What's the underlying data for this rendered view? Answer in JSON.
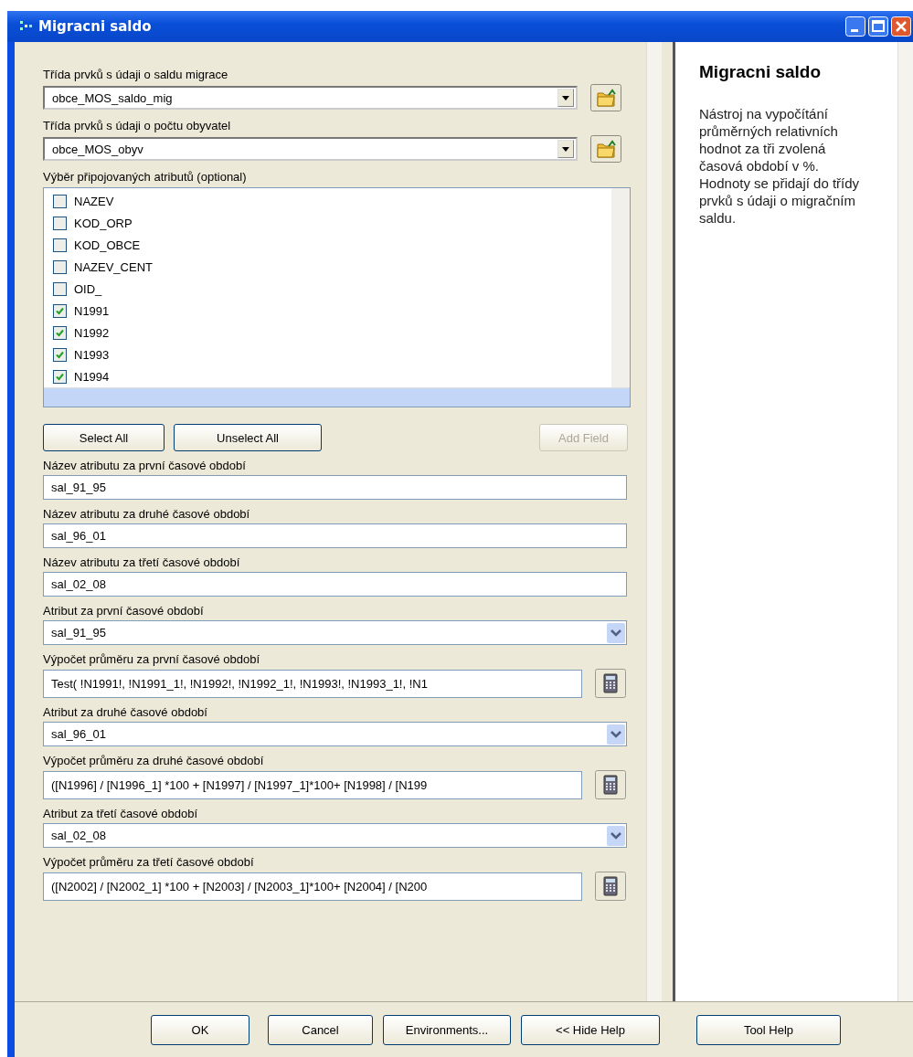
{
  "window": {
    "title": "Migracni saldo"
  },
  "form": [
    {
      "kind": "dropdown",
      "label": "Třída prvků s údaji o saldu migrace",
      "value": "obce_MOS_saldo_mig"
    },
    {
      "kind": "dropdown",
      "label": "Třída prvků s údaji o počtu obyvatel",
      "value": "obce_MOS_obyv"
    },
    {
      "kind": "checklist",
      "label": "Výběr připojovaných atributů (optional)",
      "items": [
        {
          "label": "NAZEV",
          "checked": false
        },
        {
          "label": "KOD_ORP",
          "checked": false
        },
        {
          "label": "KOD_OBCE",
          "checked": false
        },
        {
          "label": "NAZEV_CENT",
          "checked": false
        },
        {
          "label": "OID_",
          "checked": false
        },
        {
          "label": "N1991",
          "checked": true
        },
        {
          "label": "N1992",
          "checked": true
        },
        {
          "label": "N1993",
          "checked": true
        },
        {
          "label": "N1994",
          "checked": true
        }
      ]
    },
    {
      "kind": "buttons",
      "buttons": [
        {
          "label": "Select All",
          "disabled": false
        },
        {
          "label": "Unselect All",
          "disabled": false
        },
        {
          "label": "Add Field",
          "disabled": true
        }
      ]
    },
    {
      "kind": "text",
      "label": "Název atributu za první časové období",
      "value": "sal_91_95"
    },
    {
      "kind": "text",
      "label": "Název atributu za druhé časové období",
      "value": "sal_96_01"
    },
    {
      "kind": "text",
      "label": "Název atributu za třetí časové období",
      "value": "sal_02_08"
    },
    {
      "kind": "combo",
      "label": "Atribut za první časové období",
      "value": "sal_91_95"
    },
    {
      "kind": "expression",
      "label": "Výpočet průměru za první časové období",
      "value": "Test( !N1991!, !N1991_1!, !N1992!, !N1992_1!, !N1993!, !N1993_1!, !N1"
    },
    {
      "kind": "combo",
      "label": "Atribut za druhé časové období",
      "value": "sal_96_01"
    },
    {
      "kind": "expression",
      "label": "Výpočet průměru za druhé časové období",
      "value": "([N1996] / [N1996_1] *100 + [N1997] / [N1997_1]*100+ [N1998] / [N199"
    },
    {
      "kind": "combo",
      "label": "Atribut za třetí časové období",
      "value": "sal_02_08"
    },
    {
      "kind": "expression",
      "label": "Výpočet průměru za třetí časové období",
      "value": "([N2002] / [N2002_1] *100 + [N2003] / [N2003_1]*100+ [N2004] / [N200"
    }
  ],
  "help": {
    "title": "Migracni saldo",
    "text": "Nástroj na vypočítání průměrných relativních hodnot za tři zvolená časová období v %. Hodnoty se přidají do třídy prvků s údaji o migračním saldu."
  },
  "buttons": [
    {
      "label": "OK"
    },
    {
      "label": "Cancel"
    },
    {
      "label": "Environments..."
    },
    {
      "label": "<< Hide Help"
    },
    {
      "label": "Tool Help"
    }
  ]
}
